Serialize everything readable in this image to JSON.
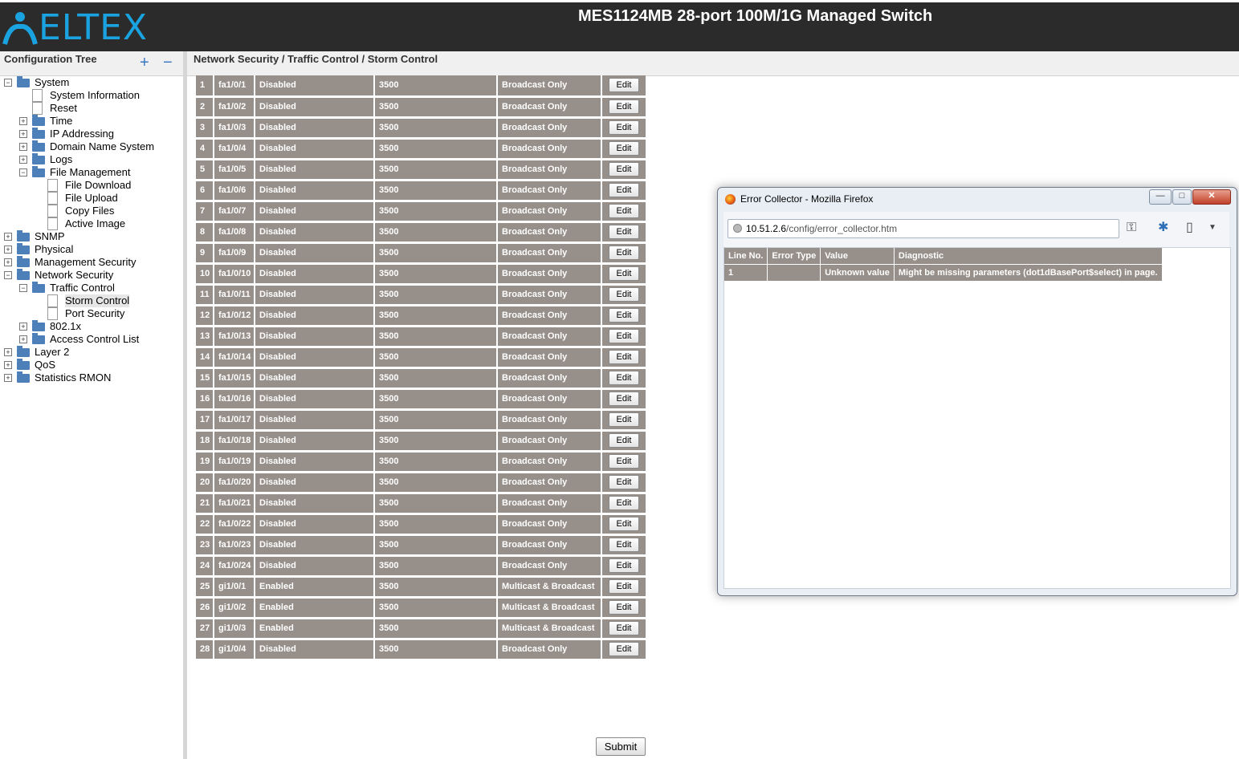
{
  "header": {
    "logo_text": "ELTEX",
    "device_title": "MES1124MB 28-port 100M/1G Managed Switch"
  },
  "sidebar": {
    "title": "Configuration Tree",
    "expand_label": "+",
    "collapse_label": "−",
    "tree": [
      {
        "label": "System",
        "level": 0,
        "type": "folder",
        "toggle": "−"
      },
      {
        "label": "System Information",
        "level": 1,
        "type": "doc",
        "toggle": ""
      },
      {
        "label": "Reset",
        "level": 1,
        "type": "doc",
        "toggle": ""
      },
      {
        "label": "Time",
        "level": 1,
        "type": "folder",
        "toggle": "+"
      },
      {
        "label": "IP Addressing",
        "level": 1,
        "type": "folder",
        "toggle": "+"
      },
      {
        "label": "Domain Name System",
        "level": 1,
        "type": "folder",
        "toggle": "+"
      },
      {
        "label": "Logs",
        "level": 1,
        "type": "folder",
        "toggle": "+"
      },
      {
        "label": "File Management",
        "level": 1,
        "type": "folder",
        "toggle": "−"
      },
      {
        "label": "File Download",
        "level": 2,
        "type": "doc",
        "toggle": ""
      },
      {
        "label": "File Upload",
        "level": 2,
        "type": "doc",
        "toggle": ""
      },
      {
        "label": "Copy Files",
        "level": 2,
        "type": "doc",
        "toggle": ""
      },
      {
        "label": "Active Image",
        "level": 2,
        "type": "doc",
        "toggle": ""
      },
      {
        "label": "SNMP",
        "level": 0,
        "type": "folder",
        "toggle": "+"
      },
      {
        "label": "Physical",
        "level": 0,
        "type": "folder",
        "toggle": "+"
      },
      {
        "label": "Management Security",
        "level": 0,
        "type": "folder",
        "toggle": "+"
      },
      {
        "label": "Network Security",
        "level": 0,
        "type": "folder",
        "toggle": "−"
      },
      {
        "label": "Traffic Control",
        "level": 1,
        "type": "folder",
        "toggle": "−"
      },
      {
        "label": "Storm Control",
        "level": 2,
        "type": "doc",
        "toggle": "",
        "selected": true
      },
      {
        "label": "Port Security",
        "level": 2,
        "type": "doc",
        "toggle": ""
      },
      {
        "label": "802.1x",
        "level": 1,
        "type": "folder",
        "toggle": "+"
      },
      {
        "label": "Access Control List",
        "level": 1,
        "type": "folder",
        "toggle": "+"
      },
      {
        "label": "Layer 2",
        "level": 0,
        "type": "folder",
        "toggle": "+"
      },
      {
        "label": "QoS",
        "level": 0,
        "type": "folder",
        "toggle": "+"
      },
      {
        "label": "Statistics RMON",
        "level": 0,
        "type": "folder",
        "toggle": "+"
      }
    ]
  },
  "breadcrumb": "Network Security / Traffic Control / Storm Control",
  "storm_table": {
    "edit_label": "Edit",
    "rows": [
      [
        "1",
        "fa1/0/1",
        "Disabled",
        "3500",
        "Broadcast Only"
      ],
      [
        "2",
        "fa1/0/2",
        "Disabled",
        "3500",
        "Broadcast Only"
      ],
      [
        "3",
        "fa1/0/3",
        "Disabled",
        "3500",
        "Broadcast Only"
      ],
      [
        "4",
        "fa1/0/4",
        "Disabled",
        "3500",
        "Broadcast Only"
      ],
      [
        "5",
        "fa1/0/5",
        "Disabled",
        "3500",
        "Broadcast Only"
      ],
      [
        "6",
        "fa1/0/6",
        "Disabled",
        "3500",
        "Broadcast Only"
      ],
      [
        "7",
        "fa1/0/7",
        "Disabled",
        "3500",
        "Broadcast Only"
      ],
      [
        "8",
        "fa1/0/8",
        "Disabled",
        "3500",
        "Broadcast Only"
      ],
      [
        "9",
        "fa1/0/9",
        "Disabled",
        "3500",
        "Broadcast Only"
      ],
      [
        "10",
        "fa1/0/10",
        "Disabled",
        "3500",
        "Broadcast Only"
      ],
      [
        "11",
        "fa1/0/11",
        "Disabled",
        "3500",
        "Broadcast Only"
      ],
      [
        "12",
        "fa1/0/12",
        "Disabled",
        "3500",
        "Broadcast Only"
      ],
      [
        "13",
        "fa1/0/13",
        "Disabled",
        "3500",
        "Broadcast Only"
      ],
      [
        "14",
        "fa1/0/14",
        "Disabled",
        "3500",
        "Broadcast Only"
      ],
      [
        "15",
        "fa1/0/15",
        "Disabled",
        "3500",
        "Broadcast Only"
      ],
      [
        "16",
        "fa1/0/16",
        "Disabled",
        "3500",
        "Broadcast Only"
      ],
      [
        "17",
        "fa1/0/17",
        "Disabled",
        "3500",
        "Broadcast Only"
      ],
      [
        "18",
        "fa1/0/18",
        "Disabled",
        "3500",
        "Broadcast Only"
      ],
      [
        "19",
        "fa1/0/19",
        "Disabled",
        "3500",
        "Broadcast Only"
      ],
      [
        "20",
        "fa1/0/20",
        "Disabled",
        "3500",
        "Broadcast Only"
      ],
      [
        "21",
        "fa1/0/21",
        "Disabled",
        "3500",
        "Broadcast Only"
      ],
      [
        "22",
        "fa1/0/22",
        "Disabled",
        "3500",
        "Broadcast Only"
      ],
      [
        "23",
        "fa1/0/23",
        "Disabled",
        "3500",
        "Broadcast Only"
      ],
      [
        "24",
        "fa1/0/24",
        "Disabled",
        "3500",
        "Broadcast Only"
      ],
      [
        "25",
        "gi1/0/1",
        "Enabled",
        "3500",
        "Multicast & Broadcast"
      ],
      [
        "26",
        "gi1/0/2",
        "Enabled",
        "3500",
        "Multicast & Broadcast"
      ],
      [
        "27",
        "gi1/0/3",
        "Enabled",
        "3500",
        "Multicast & Broadcast"
      ],
      [
        "28",
        "gi1/0/4",
        "Disabled",
        "3500",
        "Broadcast Only"
      ]
    ]
  },
  "submit_label": "Submit",
  "popup": {
    "title": "Error Collector - Mozilla Firefox",
    "minimize_label": "—",
    "maximize_label": "□",
    "close_label": "✕",
    "url_host": "10.51.2.6",
    "url_path": "/config/error_collector.htm",
    "columns": [
      "Line No.",
      "Error Type",
      "Value",
      "Diagnostic"
    ],
    "rows": [
      [
        "1",
        "",
        "Unknown value",
        "Might be missing parameters (dot1dBasePort$select)  in page."
      ]
    ]
  },
  "colors": {
    "header_bg": "#2b2b2b",
    "logo": "#1aa3e0",
    "table_cell": "#978f89"
  }
}
